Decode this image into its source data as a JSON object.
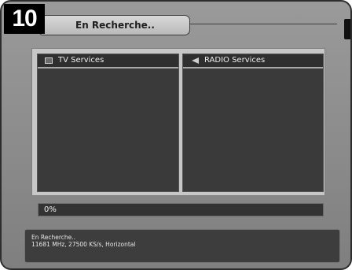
{
  "step_number": "10",
  "header": {
    "title": "En Recherche.."
  },
  "panels": {
    "tv": {
      "label": "TV Services",
      "icon": "tv-icon"
    },
    "radio": {
      "label": "RADIO Services",
      "icon": "radio-icon"
    }
  },
  "progress": {
    "label": "0%",
    "value": 0
  },
  "status": {
    "line1": "En Recherche..",
    "line2": "11681 MHz, 27500 KS/s, Horizontal"
  }
}
